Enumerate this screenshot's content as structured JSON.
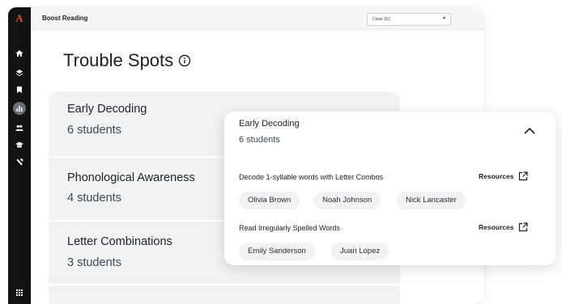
{
  "nav": {
    "logo": "A",
    "icons": [
      "home-icon",
      "layers-icon",
      "bookmark-icon",
      "chart-icon",
      "group-icon",
      "school-icon",
      "tools-icon",
      "grid-icon"
    ],
    "active": "chart-icon"
  },
  "header": {
    "app_name": "Boost Reading",
    "class_select": "Class 301"
  },
  "page": {
    "title": "Trouble Spots"
  },
  "spots": [
    {
      "name": "Early Decoding",
      "count": "6 students"
    },
    {
      "name": "Phonological Awareness",
      "count": "4 students"
    },
    {
      "name": "Letter Combinations",
      "count": "3 students"
    }
  ],
  "detail": {
    "title": "Early Decoding",
    "count": "6 students",
    "skills": [
      {
        "label": "Decode 1-syllable words with Letter Combos",
        "resources": "Resources",
        "students": [
          "Olivia Brown",
          "Noah Johnson",
          "Nick Lancaster"
        ]
      },
      {
        "label": "Read Irregularly Spelled Words",
        "resources": "Resources",
        "students": [
          "Emily Sanderson",
          "Juan Lopez"
        ]
      }
    ]
  },
  "colors": {
    "rail": "#111315",
    "logo": "#e0562a",
    "panel": "#f1f2f4"
  }
}
